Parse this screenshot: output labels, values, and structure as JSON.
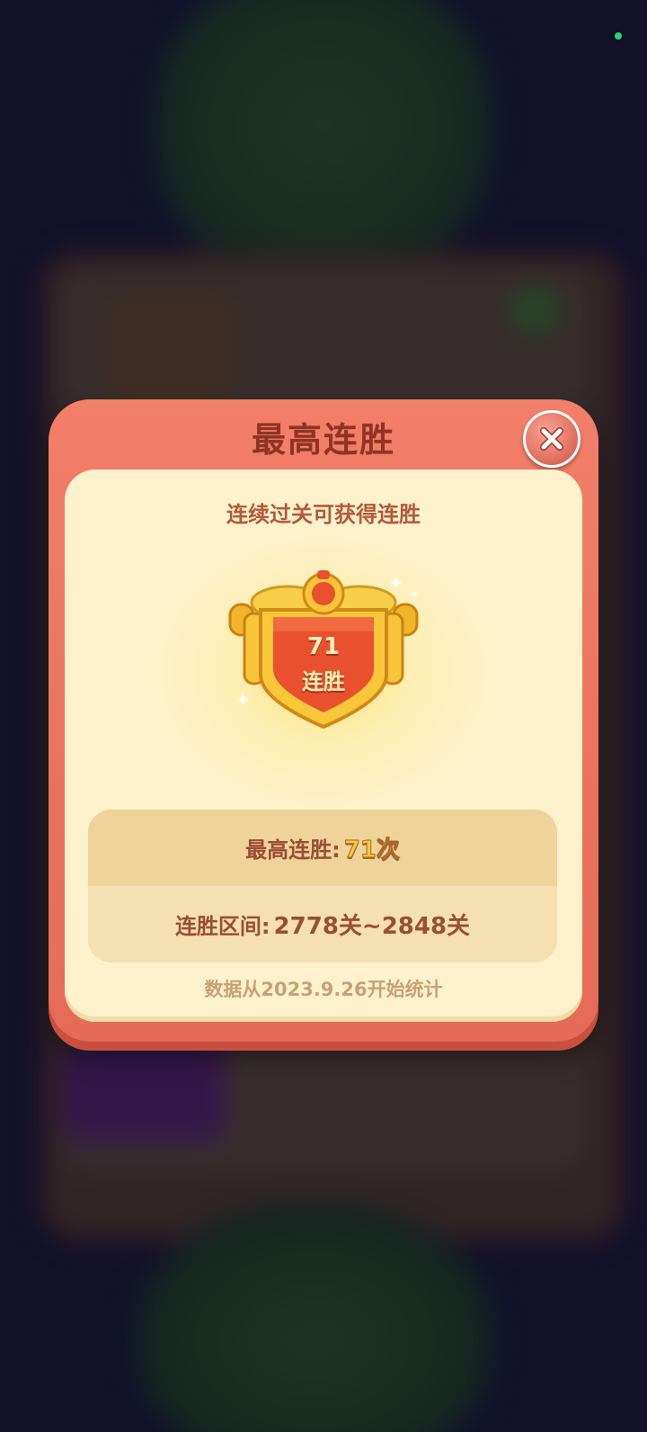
{
  "dialog": {
    "title": "最高连胜",
    "subtitle": "连续过关可获得连胜"
  },
  "badge": {
    "streak_number": "71",
    "streak_label": "连胜",
    "icon": "shield-badge-icon"
  },
  "stats": {
    "best_streak_label": "最高连胜:",
    "best_streak_value": "71次",
    "range_label": "连胜区间:",
    "range_value": "2778关~2848关"
  },
  "footnote": "数据从2023.9.26开始统计",
  "icons": {
    "close": "close-icon",
    "sparkle": "sparkle-icon"
  },
  "colors": {
    "dialog_frame": "#e66a58",
    "title_text": "#8f3424",
    "card_background": "#fdf2cc",
    "gold_value": "#f6c93a",
    "stats_text": "#9a4e36",
    "status_dot": "#2fd16a"
  }
}
